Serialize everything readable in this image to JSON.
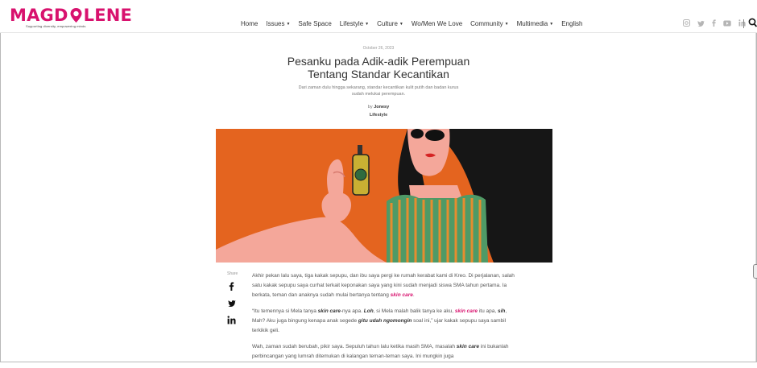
{
  "logo": {
    "wordmark": "MAGDALENE",
    "wordmark_left": "MAGD",
    "wordmark_right": "LENE",
    "tagline": "Supporting diversity, empowering minds"
  },
  "nav": {
    "items": [
      {
        "label": "Home",
        "dropdown": false
      },
      {
        "label": "Issues",
        "dropdown": true
      },
      {
        "label": "Safe Space",
        "dropdown": false
      },
      {
        "label": "Lifestyle",
        "dropdown": true
      },
      {
        "label": "Culture",
        "dropdown": true
      },
      {
        "label": "Wo/Men We Love",
        "dropdown": false
      },
      {
        "label": "Community",
        "dropdown": true
      },
      {
        "label": "Multimedia",
        "dropdown": true
      },
      {
        "label": "English",
        "dropdown": false
      }
    ]
  },
  "social_icons": [
    "instagram-icon",
    "twitter-icon",
    "facebook-icon",
    "youtube-icon",
    "linkedin-icon"
  ],
  "article": {
    "date": "October 26, 2023",
    "title_line1": "Pesanku pada Adik-adik Perempuan",
    "title_line2": "Tentang Standar Kecantikan",
    "summary": "Dari zaman dulu hingga sekarang, standar kecantikan kulit putih dan badan kurus sudah melukai perempuan.",
    "by_label": "by",
    "author": "Jonesy",
    "category": "Lifestyle",
    "share_label": "Share",
    "paragraphs": {
      "p1_a": "Akhir pekan lalu saya, tiga kakak sepupu, dan ibu saya pergi ke rumah kerabat kami di Kreo. Di perjalanan, salah satu kakak sepupu saya curhat terkait keponakan saya yang kini sudah menjadi siswa SMA tahun pertama. Ia berkata, teman dan anaknya sudah mulai bertanya tentang ",
      "p1_kw": "skin care",
      "p1_end": ".",
      "p2_a": "“Itu temennya si Mela tanya ",
      "p2_kw1": "skin care",
      "p2_b": "-nya apa. ",
      "p2_em1": "Loh",
      "p2_c": ", si Mela malah balik tanya ke aku, ",
      "p2_kw2": "skin care",
      "p2_d": " itu apa, ",
      "p2_em2": "sih",
      "p2_e": ", Mah? Aku juga bingung kenapa anak segede ",
      "p2_em3": "gitu udah ngomongin",
      "p2_f": " soal ini,” ujar kakak sepupu saya sambil terkikik geli.",
      "p3_a": "Wah, zaman sudah berubah, pikir saya. Sepuluh tahun lalu ketika masih SMA, masalah ",
      "p3_em": "skin care",
      "p3_b": " ini bukanlah perbincangan yang lumrah ditemukan di kalangan teman-teman saya. Ini mungkin juga"
    }
  },
  "colors": {
    "brand": "#d8126e",
    "hero_bg": "#e4641f",
    "skin": "#f4a79a",
    "hair": "#1a1a1a",
    "bottle": "#c9b033"
  }
}
